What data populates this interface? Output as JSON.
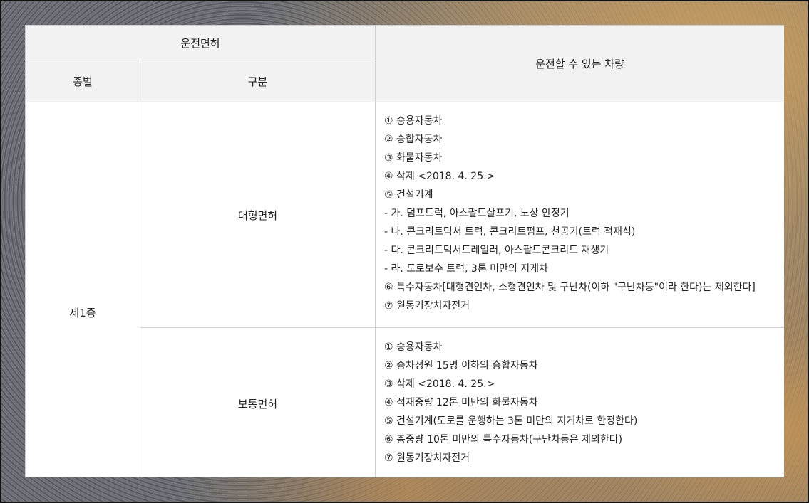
{
  "table": {
    "header": {
      "license": "운전면허",
      "vehicles": "운전할 수 있는 차량",
      "type": "종별",
      "category": "구분"
    },
    "kind": "제1종",
    "rows": [
      {
        "category": "대형면허",
        "items": [
          "① 승용자동차",
          "② 승합자동차",
          "③ 화물자동차",
          "④ 삭제 <2018. 4. 25.>",
          "⑤ 건설기계",
          "- 가. 덤프트럭, 아스팔트살포기, 노상 안정기",
          "- 나. 콘크리트믹서 트럭, 콘크리트펌프, 천공기(트럭 적재식)",
          "- 다. 콘크리트믹서트레일러, 아스팔트콘크리트 재생기",
          "- 라. 도로보수 트럭, 3톤 미만의 지게차",
          "⑥ 특수자동차[대형견인차, 소형견인차 및 구난차(이하 \"구난차등\"이라 한다)는 제외한다]",
          "⑦ 원동기장치자전거"
        ]
      },
      {
        "category": "보통면허",
        "items": [
          "① 승용자동차",
          "② 승차정원 15명 이하의 승합자동차",
          "③ 삭제 <2018. 4. 25.>",
          "④ 적재중량 12톤 미만의 화물자동차",
          "⑤ 건설기계(도로를 운행하는 3톤 미만의 지게차로 한정한다)",
          "⑥ 총중량 10톤 미만의 특수자동차(구난차등은 제외한다)",
          "⑦ 원동기장치자전거"
        ]
      }
    ]
  }
}
